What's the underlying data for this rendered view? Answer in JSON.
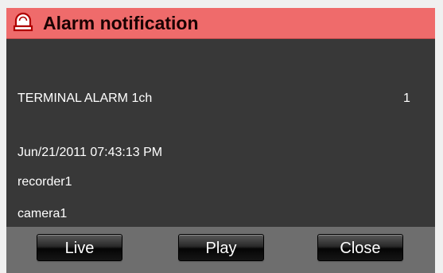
{
  "window": {
    "title": "Alarm notification"
  },
  "alarm": {
    "name": "TERMINAL ALARM 1ch",
    "count": "1",
    "timestamp": "Jun/21/2011 07:43:13 PM",
    "recorder": "recorder1",
    "camera": "camera1"
  },
  "buttons": {
    "live_label": "Live",
    "play_label": "Play",
    "close_label": "Close"
  },
  "icons": {
    "title_icon": "alarm-bell-icon"
  },
  "colors": {
    "title_bar": "#ef6b6b",
    "content_bg": "#383838",
    "button_bar": "#6e6e6e"
  }
}
